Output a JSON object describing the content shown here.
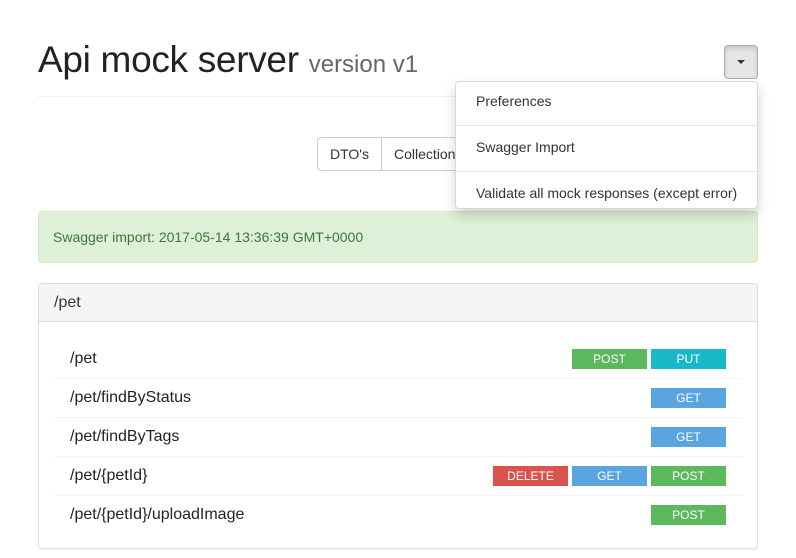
{
  "header": {
    "title": "Api mock server",
    "version": "version v1"
  },
  "actions_menu": {
    "icon": "caret-down-icon",
    "items": [
      {
        "label": "Preferences"
      },
      {
        "label": "Swagger Import"
      },
      {
        "label": "Validate all mock responses (except error)"
      }
    ]
  },
  "view_toggle": {
    "buttons": [
      {
        "label": "DTO's"
      },
      {
        "label": "Collection"
      }
    ]
  },
  "alert": {
    "text": "Swagger import: 2017-05-14 13:36:39 GMT+0000"
  },
  "panel": {
    "title": "/pet",
    "endpoints": [
      {
        "path": "/pet",
        "methods": [
          "POST",
          "PUT"
        ]
      },
      {
        "path": "/pet/findByStatus",
        "methods": [
          "GET"
        ]
      },
      {
        "path": "/pet/findByTags",
        "methods": [
          "GET"
        ]
      },
      {
        "path": "/pet/{petId}",
        "methods": [
          "DELETE",
          "GET",
          "POST"
        ]
      },
      {
        "path": "/pet/{petId}/uploadImage",
        "methods": [
          "POST"
        ]
      }
    ]
  },
  "colors": {
    "post": "#5cb85c",
    "put": "#17b8c8",
    "get": "#5aa5e0",
    "delete": "#d9534f",
    "alert_bg": "#dff0d8",
    "alert_text": "#3c763d"
  }
}
